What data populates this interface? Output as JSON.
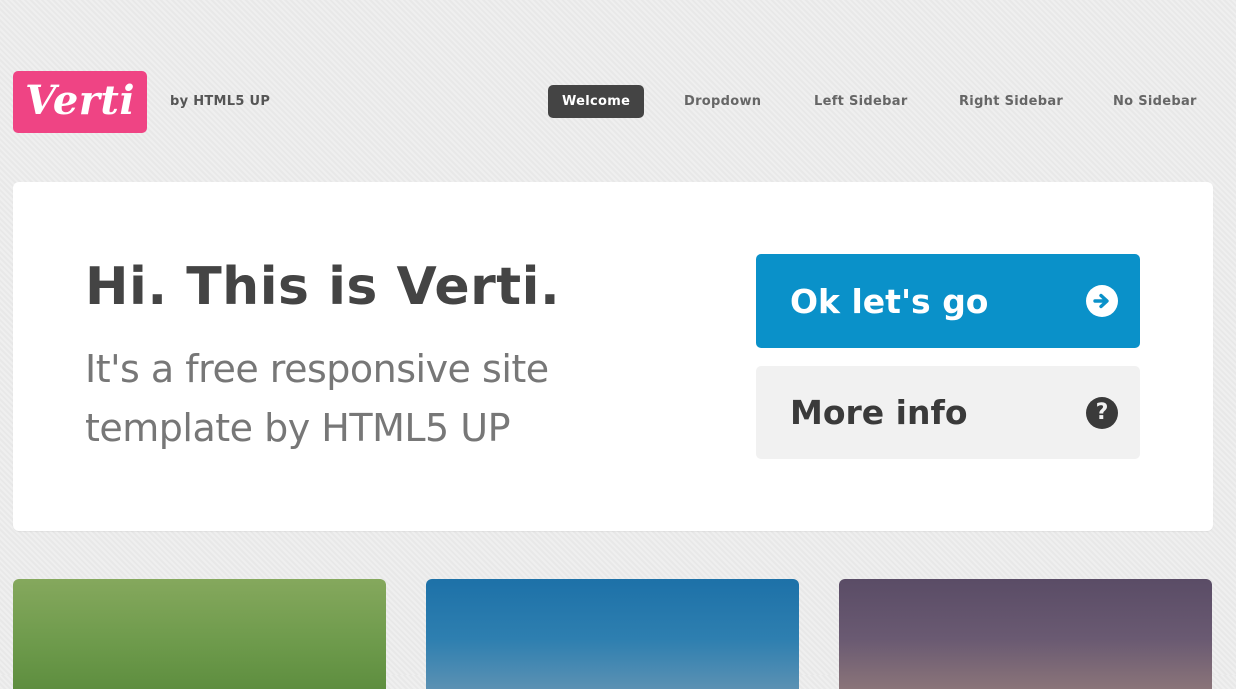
{
  "header": {
    "logo_text": "Verti",
    "byline": "by HTML5 UP",
    "nav": [
      {
        "label": "Welcome",
        "active": true
      },
      {
        "label": "Dropdown",
        "active": false
      },
      {
        "label": "Left Sidebar",
        "active": false
      },
      {
        "label": "Right Sidebar",
        "active": false
      },
      {
        "label": "No Sidebar",
        "active": false
      }
    ]
  },
  "banner": {
    "title": "Hi. This is Verti.",
    "subtitle": "It's a free responsive site template by HTML5 UP",
    "primary_button": {
      "label": "Ok let's go",
      "icon": "arrow-right-circle-icon"
    },
    "secondary_button": {
      "label": "More info",
      "icon": "question-circle-icon"
    }
  },
  "colors": {
    "brand": "#ef4484",
    "primary_button": "#0a91c9",
    "nav_active": "#444444",
    "tile_green": "#6d9a4b",
    "tile_blue": "#2e7fb0",
    "tile_purple": "#6a5a72"
  }
}
